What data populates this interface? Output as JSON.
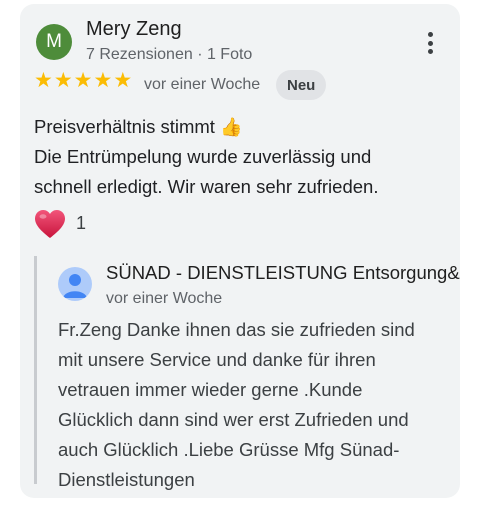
{
  "review": {
    "author_initial": "M",
    "author_name": "Mery Zeng",
    "author_meta": "7 Rezensionen · 1 Foto",
    "avatar_color": "#4e8c3a",
    "more_icon": "more-vert-icon",
    "rating": 5,
    "star_color": "#fbbc04",
    "time_ago": "vor einer Woche",
    "badge": "Neu",
    "text_lines": [
      "Preisverhältnis stimmt",
      "Die Entrümpelung wurde zuverlässig und",
      "schnell erledigt. Wir waren sehr zufrieden."
    ],
    "text_emoji": "thumbs-up-icon",
    "reaction_icon": "heart-icon",
    "reaction_count": "1"
  },
  "owner_reply": {
    "name": "SÜNAD - DIENSTLEISTUNG Entsorgung&E",
    "time_ago": "vor einer Woche",
    "avatar_icon": "person-icon",
    "text_lines": [
      "Fr.Zeng Danke ihnen das sie zufrieden sind",
      "mit unsere Service und danke für ihren",
      "vetrauen immer wieder gerne .Kunde",
      "Glücklich dann sind wer erst Zufrieden und",
      "auch Glücklich .Liebe Grüsse Mfg Sünad-",
      "Dienstleistungen"
    ]
  }
}
